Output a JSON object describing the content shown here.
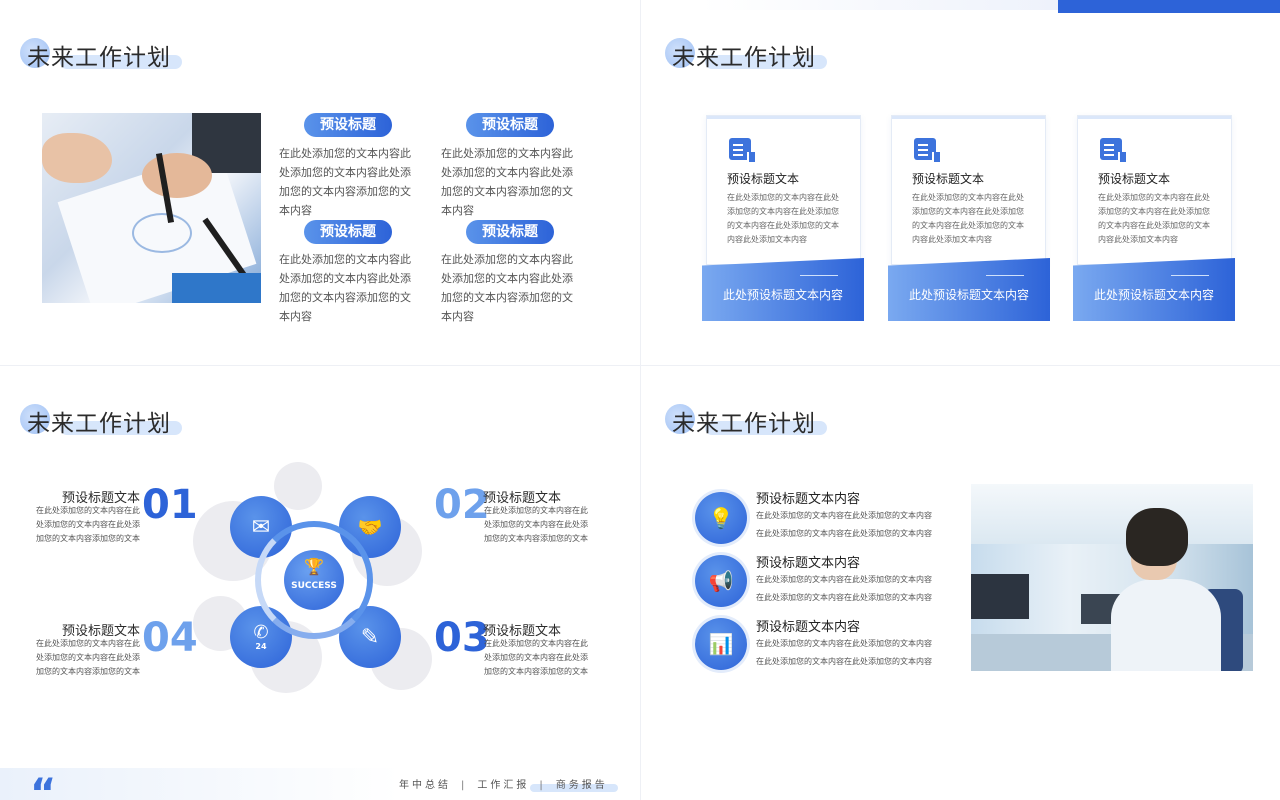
{
  "slides": {
    "s1": {
      "title": "未来工作计划",
      "items": [
        {
          "label": "预设标题",
          "text": "在此处添加您的文本内容此处添加您的文本内容此处添加您的文本内容添加您的文本内容"
        },
        {
          "label": "预设标题",
          "text": "在此处添加您的文本内容此处添加您的文本内容此处添加您的文本内容添加您的文本内容"
        },
        {
          "label": "预设标题",
          "text": "在此处添加您的文本内容此处添加您的文本内容此处添加您的文本内容添加您的文本内容"
        },
        {
          "label": "预设标题",
          "text": "在此处添加您的文本内容此处添加您的文本内容此处添加您的文本内容添加您的文本内容"
        }
      ]
    },
    "s2": {
      "title": "未来工作计划",
      "cards": [
        {
          "title": "预设标题文本",
          "text": "在此处添加您的文本内容在此处添加您的文本内容在此处添加您的文本内容在此处添加您的文本内容此处添加文本内容",
          "footer": "此处预设标题文本内容"
        },
        {
          "title": "预设标题文本",
          "text": "在此处添加您的文本内容在此处添加您的文本内容在此处添加您的文本内容在此处添加您的文本内容此处添加文本内容",
          "footer": "此处预设标题文本内容"
        },
        {
          "title": "预设标题文本",
          "text": "在此处添加您的文本内容在此处添加您的文本内容在此处添加您的文本内容在此处添加您的文本内容此处添加文本内容",
          "footer": "此处预设标题文本内容"
        }
      ]
    },
    "s3": {
      "title": "未来工作计划",
      "center_label": "SUCCESS",
      "center_icon": "trophy-icon",
      "blocks": [
        {
          "num": "01",
          "title": "预设标题文本",
          "text": "在此处添加您的文本内容在此处添加您的文本内容在此处添加您的文本内容添加您的文本"
        },
        {
          "num": "02",
          "title": "预设标题文本",
          "text": "在此处添加您的文本内容在此处添加您的文本内容在此处添加您的文本内容添加您的文本"
        },
        {
          "num": "03",
          "title": "预设标题文本",
          "text": "在此处添加您的文本内容在此处添加您的文本内容在此处添加您的文本内容添加您的文本"
        },
        {
          "num": "04",
          "title": "预设标题文本",
          "text": "在此处添加您的文本内容在此处添加您的文本内容在此处添加您的文本内容添加您的文本"
        }
      ],
      "icons": [
        "mail-icon",
        "handshake-icon",
        "phone-24-icon",
        "pencil-icon"
      ],
      "phone_badge": "24"
    },
    "s4": {
      "title": "未来工作计划",
      "items": [
        {
          "title": "预设标题文本内容",
          "line1": "在此处添加您的文本内容在此处添加您的文本内容",
          "line2": "在此处添加您的文本内容在此处添加您的文本内容",
          "icon": "lightbulb-icon"
        },
        {
          "title": "预设标题文本内容",
          "line1": "在此处添加您的文本内容在此处添加您的文本内容",
          "line2": "在此处添加您的文本内容在此处添加您的文本内容",
          "icon": "megaphone-icon"
        },
        {
          "title": "预设标题文本内容",
          "line1": "在此处添加您的文本内容在此处添加您的文本内容",
          "line2": "在此处添加您的文本内容在此处添加您的文本内容",
          "icon": "presentation-board-icon"
        }
      ]
    }
  },
  "footer": {
    "quote_mark": "“",
    "words": [
      "年中总结",
      "工作汇报",
      "商务报告"
    ],
    "separator": "|"
  },
  "colors": {
    "accent": "#2d63d8",
    "accent_light": "#5a93ea",
    "grey_bubble": "#ececf0"
  }
}
